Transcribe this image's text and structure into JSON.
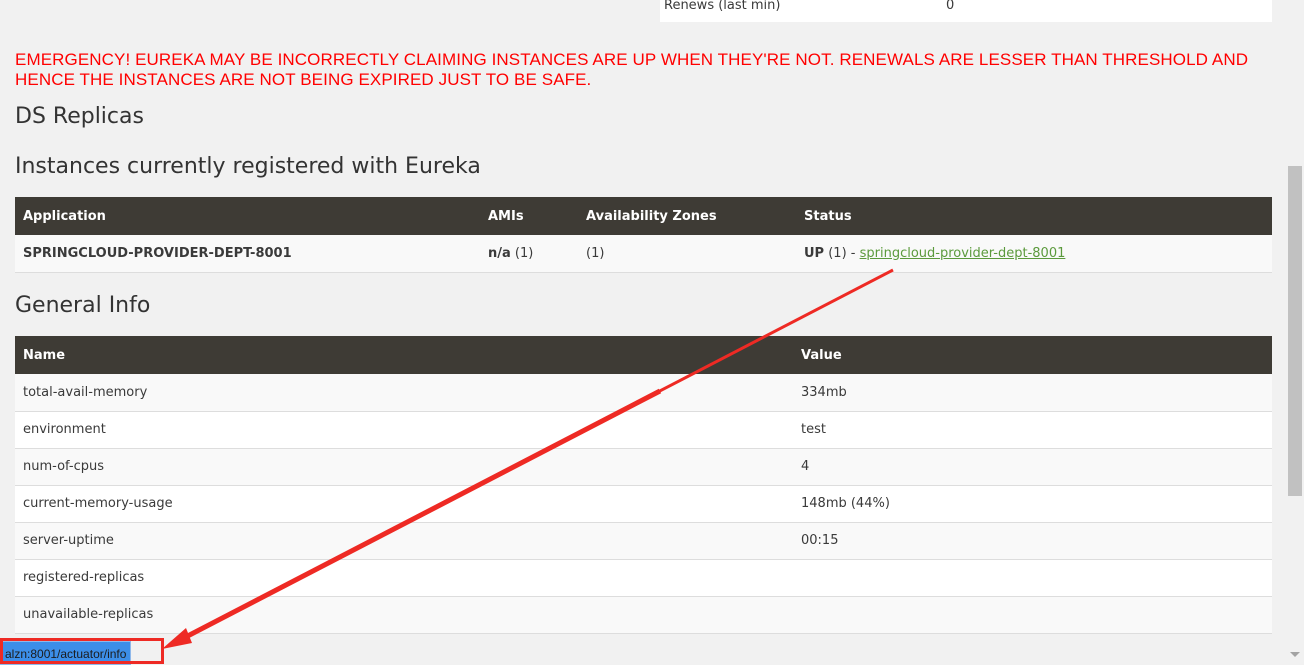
{
  "renews": {
    "name": "Renews (last min)",
    "value": "0"
  },
  "emergency_message": "EMERGENCY! EUREKA MAY BE INCORRECTLY CLAIMING INSTANCES ARE UP WHEN THEY'RE NOT. RENEWALS ARE LESSER THAN THRESHOLD AND HENCE THE INSTANCES ARE NOT BEING EXPIRED JUST TO BE SAFE.",
  "headings": {
    "ds_replicas": "DS Replicas",
    "instances": "Instances currently registered with Eureka",
    "general_info": "General Info"
  },
  "instances_table": {
    "headers": [
      "Application",
      "AMIs",
      "Availability Zones",
      "Status"
    ],
    "row": {
      "application": "SPRINGCLOUD-PROVIDER-DEPT-8001",
      "amis_bold": "n/a",
      "amis_count": " (1)",
      "zones": "(1)",
      "status_bold": "UP",
      "status_count": " (1) - ",
      "status_link": "springcloud-provider-dept-8001"
    }
  },
  "general_info_table": {
    "headers": [
      "Name",
      "Value"
    ],
    "rows": [
      {
        "name": "total-avail-memory",
        "value": "334mb"
      },
      {
        "name": "environment",
        "value": "test"
      },
      {
        "name": "num-of-cpus",
        "value": "4"
      },
      {
        "name": "current-memory-usage",
        "value": "148mb (44%)"
      },
      {
        "name": "server-uptime",
        "value": "00:15"
      },
      {
        "name": "registered-replicas",
        "value": ""
      },
      {
        "name": "unavailable-replicas",
        "value": ""
      }
    ]
  },
  "status_bar_url": "alzn:8001/actuator/info",
  "colors": {
    "emergency": "#ff0000",
    "table_header": "#3e3b35",
    "link": "#5b9a3c",
    "annotation": "#ee2a24"
  }
}
